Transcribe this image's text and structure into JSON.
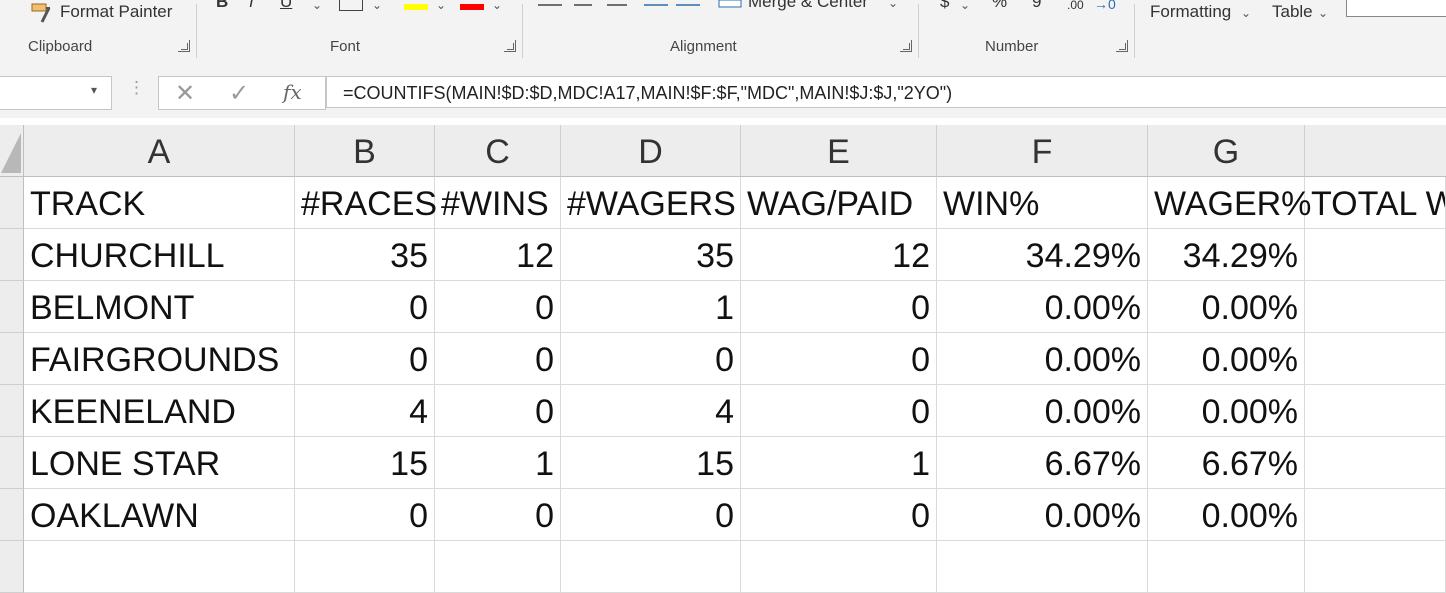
{
  "ribbon": {
    "format_painter": "Format Painter",
    "merge_center": "Merge & Center",
    "formatting": "Formatting",
    "table": "Table",
    "groups": {
      "clipboard": "Clipboard",
      "font": "Font",
      "alignment": "Alignment",
      "number": "Number"
    },
    "currency_symbol": "$",
    "percent_symbol": "%",
    "comma_symbol": "9",
    "decimal_label": ".00"
  },
  "formula_bar": {
    "fx": "fx",
    "formula": "=COUNTIFS(MAIN!$D:$D,MDC!A17,MAIN!$F:$F,\"MDC\",MAIN!$J:$J,\"2YO\")"
  },
  "columns": [
    "A",
    "B",
    "C",
    "D",
    "E",
    "F",
    "G"
  ],
  "headers": [
    "TRACK",
    "#RACES",
    "#WINS",
    "#WAGERS",
    "WAG/PAID",
    "WIN%",
    "WAGER%",
    "TOTAL W"
  ],
  "rows": [
    [
      "CHURCHILL",
      "35",
      "12",
      "35",
      "12",
      "34.29%",
      "34.29%"
    ],
    [
      "BELMONT",
      "0",
      "0",
      "1",
      "0",
      "0.00%",
      "0.00%"
    ],
    [
      "FAIRGROUNDS",
      "0",
      "0",
      "0",
      "0",
      "0.00%",
      "0.00%"
    ],
    [
      "KEENELAND",
      "4",
      "0",
      "4",
      "0",
      "0.00%",
      "0.00%"
    ],
    [
      "LONE STAR",
      "15",
      "1",
      "15",
      "1",
      "6.67%",
      "6.67%"
    ],
    [
      "OAKLAWN",
      "0",
      "0",
      "0",
      "0",
      "0.00%",
      "0.00%"
    ]
  ]
}
